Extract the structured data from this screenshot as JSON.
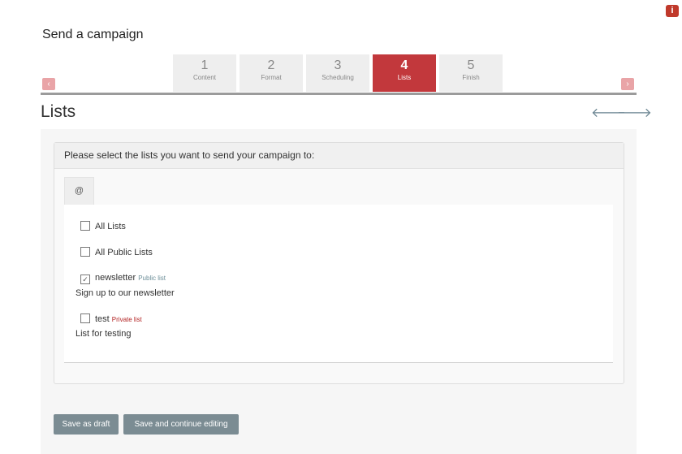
{
  "header": {
    "title": "Send a campaign",
    "info_badge": "i"
  },
  "steps": [
    {
      "number": "1",
      "label": "Content"
    },
    {
      "number": "2",
      "label": "Format"
    },
    {
      "number": "3",
      "label": "Scheduling"
    },
    {
      "number": "4",
      "label": "Lists"
    },
    {
      "number": "5",
      "label": "Finish"
    }
  ],
  "active_step": "4",
  "nav": {
    "prev_glyph": "‹",
    "next_glyph": "›",
    "back_arrow": "🡐",
    "forward_arrow": "🡒"
  },
  "section": {
    "title": "Lists"
  },
  "panel": {
    "heading": "Please select the lists you want to send your campaign to:",
    "tab_label": "@"
  },
  "lists": [
    {
      "label": "All Lists",
      "checked": false
    },
    {
      "label": "All Public Lists",
      "checked": false
    },
    {
      "label": "newsletter",
      "checked": true,
      "tag": "Public list",
      "description": "Sign up to our newsletter"
    },
    {
      "label": "test",
      "checked": false,
      "tag": "Private list",
      "description": "List for testing"
    }
  ],
  "buttons": {
    "save_draft": "Save as draft",
    "save_continue": "Save and continue editing"
  },
  "colors": {
    "accent": "#c2383c",
    "button": "#7b8c93",
    "public_tag": "#6d8f99",
    "private_tag": "#b22222"
  }
}
